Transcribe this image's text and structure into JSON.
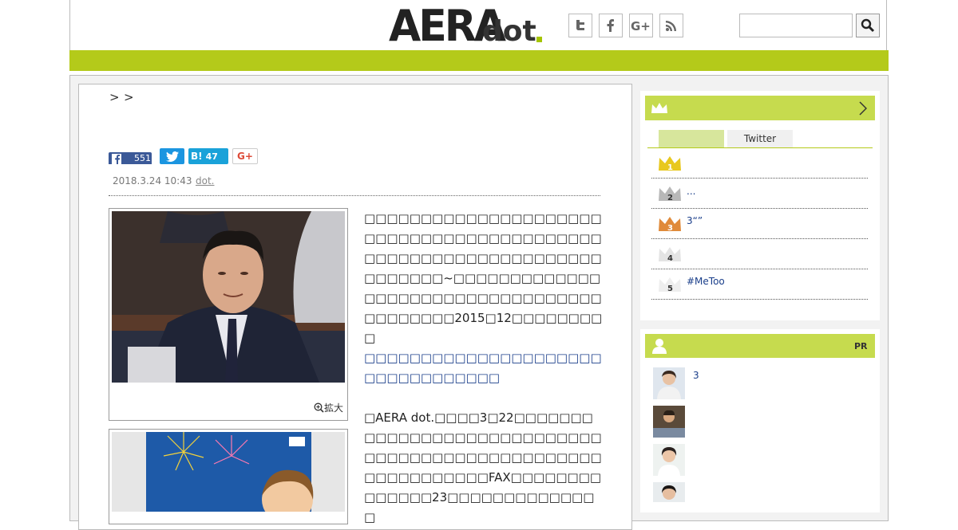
{
  "header": {
    "logo_word": "AERA",
    "logo_dot": "dot",
    "search_placeholder": ""
  },
  "breadcrumb": {
    "separators": [
      ">",
      ">"
    ]
  },
  "share": {
    "facebook_count": "551",
    "hatena_label": "B!",
    "hatena_count": "47",
    "googleplus_label": "G+"
  },
  "article": {
    "date": "2018.3.24 10:43",
    "source": "dot.",
    "photo_zoom_label": "拡大",
    "para1": "□□□□□□□□□□□□□□□□□□□□□□□□□□□□□□□□□□□□□□□□□□□□□□□□□□□□□□□□□□□□□□□□□□□□□□~□□□□□□□□□□□□□□□□□□□□□□□□□□□□□□□□□□□□□□□□□□2015□12□□□□□□□□□",
    "lead_link": "□□□□□□□□□□□□□□□□□□□□□□□□□□□□□□□□□",
    "para2": "□AERA dot.□□□□3□22□□□□□□□□□□□□□□□□□□□□□□□□□□□□□□□□□□□□□□□□□□□□□□□□□□□□□□□□□□□□FAX□□□□□□□□□□□□□□23□□□□□□□□□□□□□□"
  },
  "ranking": {
    "tabs": [
      {
        "label": ""
      },
      {
        "label": "Twitter"
      }
    ],
    "items": [
      {
        "rank": "1",
        "title": "",
        "color": "#e8c81e"
      },
      {
        "rank": "2",
        "title": "...",
        "color": "#b8b8b8"
      },
      {
        "rank": "3",
        "title": "3“”",
        "color": "#e08a3a"
      },
      {
        "rank": "4",
        "title": "",
        "color": "#e4e4e4"
      },
      {
        "rank": "5",
        "title": "#MeToo",
        "color": "#eeeeee"
      }
    ]
  },
  "pr": {
    "label": "PR",
    "items": [
      {
        "title": "3"
      },
      {
        "title": ""
      },
      {
        "title": ""
      },
      {
        "title": ""
      }
    ]
  },
  "colors": {
    "brand_green": "#b4ca1a",
    "sidebar_header_green": "#c6db4e",
    "link_blue": "#1a3e8a"
  }
}
